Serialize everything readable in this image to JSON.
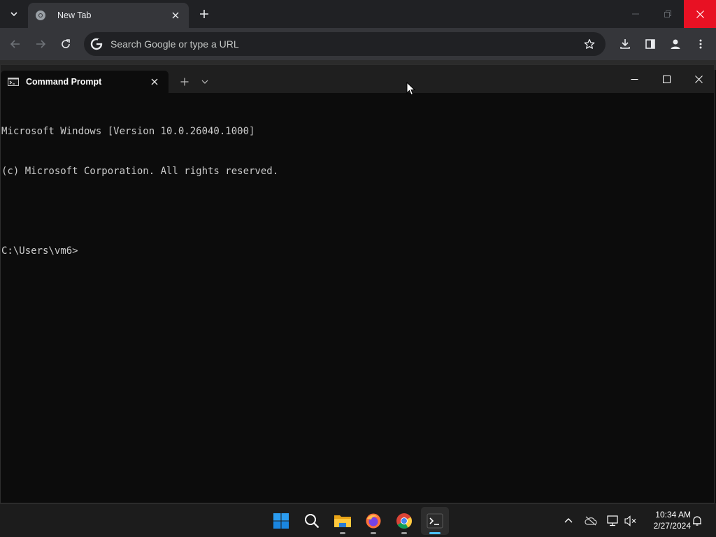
{
  "chrome": {
    "tab": {
      "title": "New Tab"
    },
    "omnibox": {
      "placeholder": "Search Google or type a URL"
    },
    "colors": {
      "close_hover": "#e81123",
      "tab_bg": "#35363a",
      "frame_bg": "#202124"
    }
  },
  "terminal": {
    "tab": {
      "title": "Command Prompt"
    },
    "lines": [
      "Microsoft Windows [Version 10.0.26040.1000]",
      "(c) Microsoft Corporation. All rights reserved.",
      "",
      "C:\\Users\\vm6>"
    ]
  },
  "taskbar": {
    "apps": [
      {
        "name": "start",
        "icon": "windows-logo-icon"
      },
      {
        "name": "search",
        "icon": "search-icon"
      },
      {
        "name": "file-explorer",
        "icon": "folder-icon"
      },
      {
        "name": "firefox",
        "icon": "firefox-icon"
      },
      {
        "name": "chrome",
        "icon": "chrome-icon"
      },
      {
        "name": "terminal",
        "icon": "terminal-icon"
      }
    ],
    "clock": {
      "time": "10:34 AM",
      "date": "2/27/2024"
    },
    "colors": {
      "active_indicator": "#4cc2ff",
      "start_blue": "#0078d4"
    }
  }
}
